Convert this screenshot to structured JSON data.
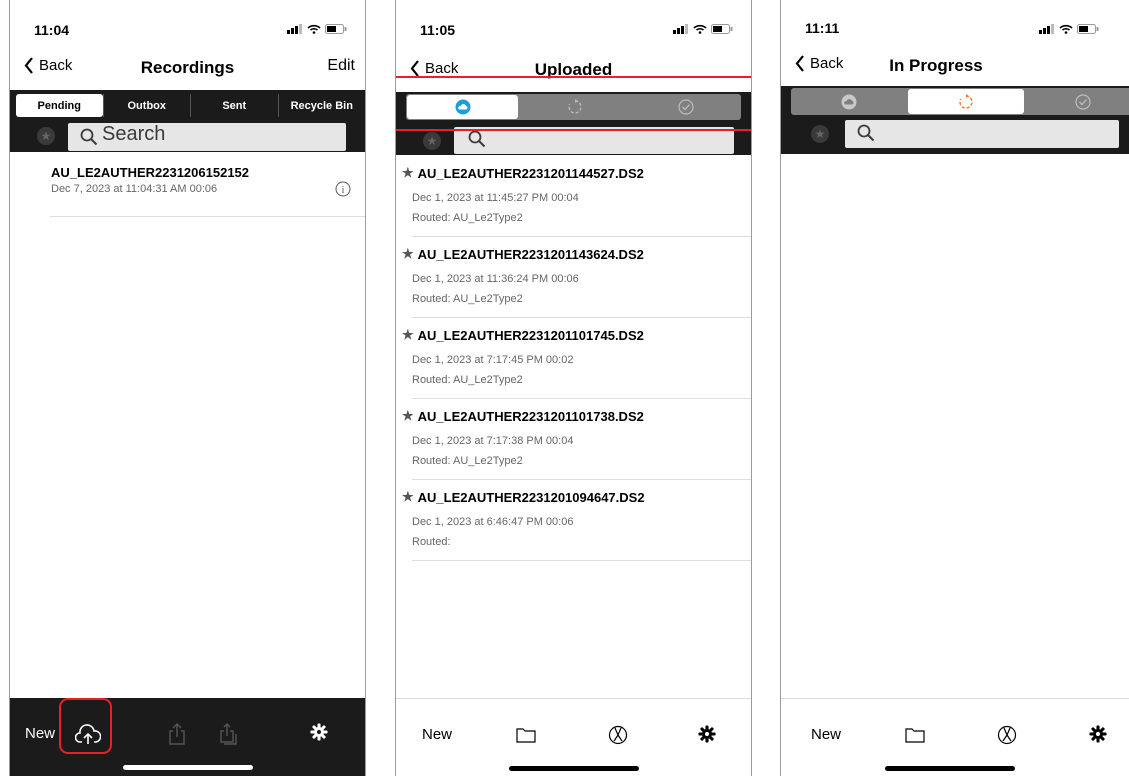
{
  "screens": [
    {
      "time": "11:04",
      "back": "Back",
      "title": "Recordings",
      "edit": "Edit",
      "tabs": [
        "Pending",
        "Outbox",
        "Sent",
        "Recycle Bin"
      ],
      "active_tab": "Pending",
      "search_placeholder": "Search",
      "items": [
        {
          "name": "AU_LE2AUTHER2231206152152",
          "meta": "Dec 7, 2023 at 11:04:31 AM    00:06"
        }
      ],
      "tabbar": {
        "new": "New",
        "icons": [
          "cloud-upload-icon",
          "share-icon",
          "share-multiple-icon",
          "settings-icon"
        ]
      }
    },
    {
      "time": "11:05",
      "back": "Back",
      "title": "Uploaded",
      "segments": [
        "cloud-icon",
        "in-progress-icon",
        "check-circle-icon"
      ],
      "active_segment": "cloud-icon",
      "items": [
        {
          "name": "AU_LE2AUTHER2231201144527.DS2",
          "meta": "Dec 1, 2023 at 11:45:27 PM    00:04",
          "routed": "Routed: AU_Le2Type2"
        },
        {
          "name": "AU_LE2AUTHER2231201143624.DS2",
          "meta": "Dec 1, 2023 at 11:36:24 PM    00:06",
          "routed": "Routed: AU_Le2Type2"
        },
        {
          "name": "AU_LE2AUTHER2231201101745.DS2",
          "meta": "Dec 1, 2023 at 7:17:45 PM    00:02",
          "routed": "Routed: AU_Le2Type2"
        },
        {
          "name": "AU_LE2AUTHER2231201101738.DS2",
          "meta": "Dec 1, 2023 at 7:17:38 PM    00:04",
          "routed": "Routed: AU_Le2Type2"
        },
        {
          "name": "AU_LE2AUTHER2231201094647.DS2",
          "meta": "Dec 1, 2023 at 6:46:47 PM    00:06",
          "routed": "Routed:"
        }
      ],
      "tabbar": {
        "new": "New",
        "icons": [
          "folder-icon",
          "dictation-icon",
          "settings-icon"
        ]
      }
    },
    {
      "time": "11:11",
      "back": "Back",
      "title": "In Progress",
      "segments": [
        "cloud-icon",
        "in-progress-icon",
        "check-circle-icon"
      ],
      "active_segment": "in-progress-icon",
      "items": [],
      "tabbar": {
        "new": "New",
        "icons": [
          "folder-icon",
          "dictation-icon",
          "settings-icon"
        ]
      }
    }
  ],
  "colors": {
    "highlight": "#e8202a",
    "accent_blue": "#1aa0d8",
    "progress_orange": "#f07a3a",
    "dark_bar": "#1b1b1b"
  }
}
